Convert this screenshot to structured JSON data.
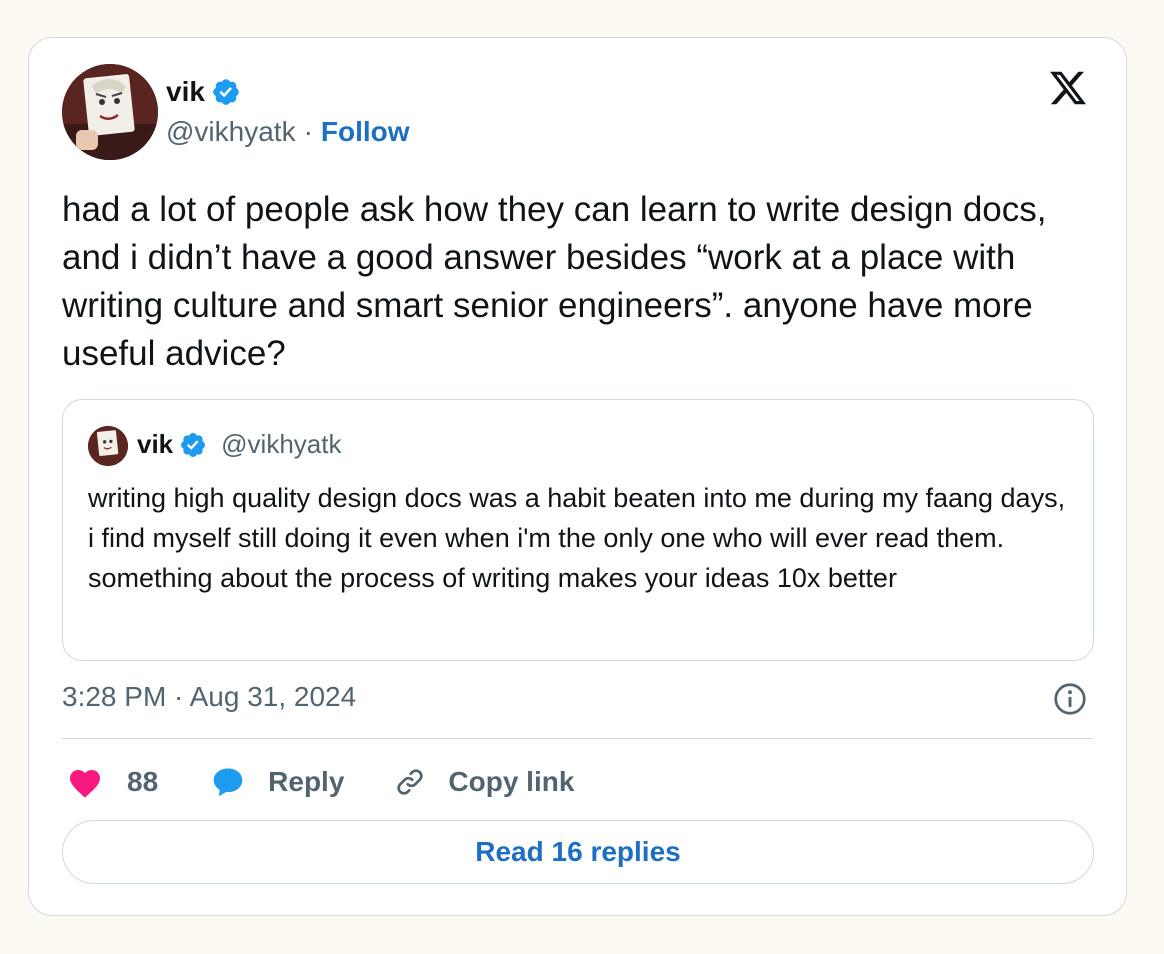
{
  "author": {
    "name": "vik",
    "handle": "@vikhyatk",
    "separator": "·",
    "follow_label": "Follow"
  },
  "tweet": {
    "text": "had a lot of people ask how they can learn to write design docs, and i didn’t have a good answer besides “work at a place with writing culture and smart senior engineers”. anyone have more useful advice?"
  },
  "quote": {
    "name": "vik",
    "handle": "@vikhyatk",
    "text": "writing high quality design docs was a habit beaten into me during my faang days, i find myself still doing it even when i'm the only one who will ever read them. something about the process of writing makes your ideas 10x better"
  },
  "meta": {
    "timestamp": "3:28 PM · Aug 31, 2024"
  },
  "actions": {
    "like_count": "88",
    "reply_label": "Reply",
    "copy_label": "Copy link"
  },
  "read_replies_label": "Read 16 replies",
  "colors": {
    "accent": "#1d6fc4",
    "verified": "#1d9bf0",
    "like": "#f91880",
    "muted": "#536471",
    "border": "#cfd9de",
    "background": "#fdfaf3"
  },
  "icons": [
    "verified-badge-icon",
    "x-logo-icon",
    "info-icon",
    "heart-icon",
    "reply-bubble-icon",
    "link-icon"
  ]
}
